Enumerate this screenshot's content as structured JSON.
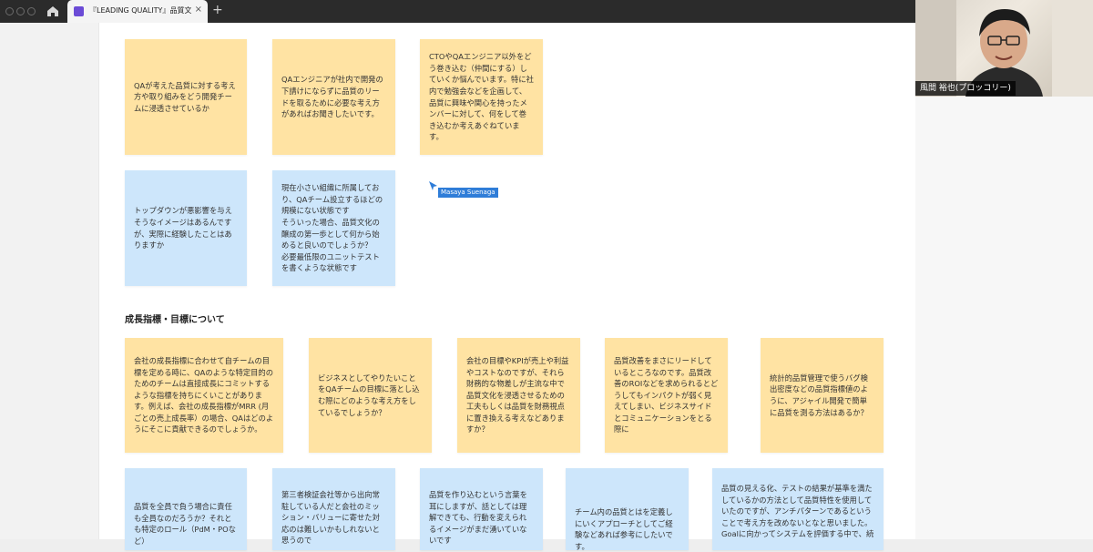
{
  "browser": {
    "tab_title": "『LEADING QUALITY』品質文化の醸",
    "tab_close": "×",
    "new_tab": "+"
  },
  "board": {
    "row1": [
      {
        "text": "QAが考えた品質に対する考え方や取り組みをどう開発チームに浸透させているか",
        "color": "#ffe3a3"
      },
      {
        "text": "QAエンジニアが社内で開発の下請けにならずに品質のリードを取るために必要な考え方があればお聞きしたいです。",
        "color": "#ffe3a3"
      },
      {
        "text": "CTOやQAエンジニア以外をどう巻き込む（仲間にする）していくか悩んでいます。特に社内で勉強会などを企画して、品質に興味や関心を持ったメンバーに対して、何をして巻き込むか考えあぐねています。",
        "color": "#ffe3a3"
      }
    ],
    "row2": [
      {
        "text": "トップダウンが悪影響を与えそうなイメージはあるんですが、実際に経験したことはありますか",
        "color": "#cde6fb"
      },
      {
        "text": "現在小さい組織に所属しており、QAチーム設立するほどの規模にない状態です\nそういった場合、品質文化の醸成の第一歩として何から始めると良いのでしょうか？\n必要最低限のユニットテストを書くような状態です",
        "color": "#cde6fb"
      }
    ],
    "cursor_user": "Masaya Suenaga",
    "section_title": "成長指標・目標について",
    "row3": [
      {
        "text": "会社の成長指標に合わせて自チームの目標を定める時に、QAのような特定目的のためのチームは直接成長にコミットするような指標を持ちにくいことがあります。例えば、会社の成長指標がMRR (月ごとの売上成長率）の場合、QAはどのようにそこに貢献できるのでしょうか。",
        "color": "#ffe3a3"
      },
      {
        "text": "ビジネスとしてやりたいことをQAチームの目標に落とし込む際にどのような考え方をしているでしょうか？",
        "color": "#ffe3a3"
      },
      {
        "text": "会社の目標やKPIが売上や利益やコストなのですが、それら財務的な物差しが主流な中で品質文化を浸透させるための工夫もしくは品質を財務視点に置き換える考えなどありますか？",
        "color": "#ffe3a3"
      },
      {
        "text": "品質改善をまさにリードしているところなのです。品質改善のROIなどを求められるとどうしてもインパクトが弱く見えてしまい、ビジネスサイドとコミュニケーションをとる際に",
        "color": "#ffe3a3"
      },
      {
        "text": "統計的品質管理で使うバグ検出密度などの品質指標値のように、アジャイル開発で簡単に品質を測る方法はあるか？",
        "color": "#ffe3a3"
      }
    ],
    "row4": [
      {
        "text": "品質を全員で負う場合に責任も全員なのだろうか？それとも特定のロール（PdM・POなど）",
        "color": "#cde6fb"
      },
      {
        "text": "第三者検証会社等から出向常駐している人だと会社のミッション・バリューに寄せた対応のは難しいかもしれないと思うので",
        "color": "#cde6fb"
      },
      {
        "text": "品質を作り込むという言葉を耳にしますが、話としては理解できても、行動を変えられるイメージがまだ湧いていないです",
        "color": "#cde6fb"
      },
      {
        "text": "チーム内の品質とはを定義しにいくアプローチとしてご経験などあれば参考にしたいです。",
        "color": "#cde6fb"
      },
      {
        "text": "品質の見える化、テストの結果が基準を満たしているかの方法として品質特性を使用していたのですが、アンチパターンであるということで考え方を改めないとなと思いました。Goalに向かってシステムを評価する中で、続",
        "color": "#cde6fb"
      }
    ]
  },
  "video": {
    "participant_name": "風間 裕也(プロッコリー)"
  }
}
